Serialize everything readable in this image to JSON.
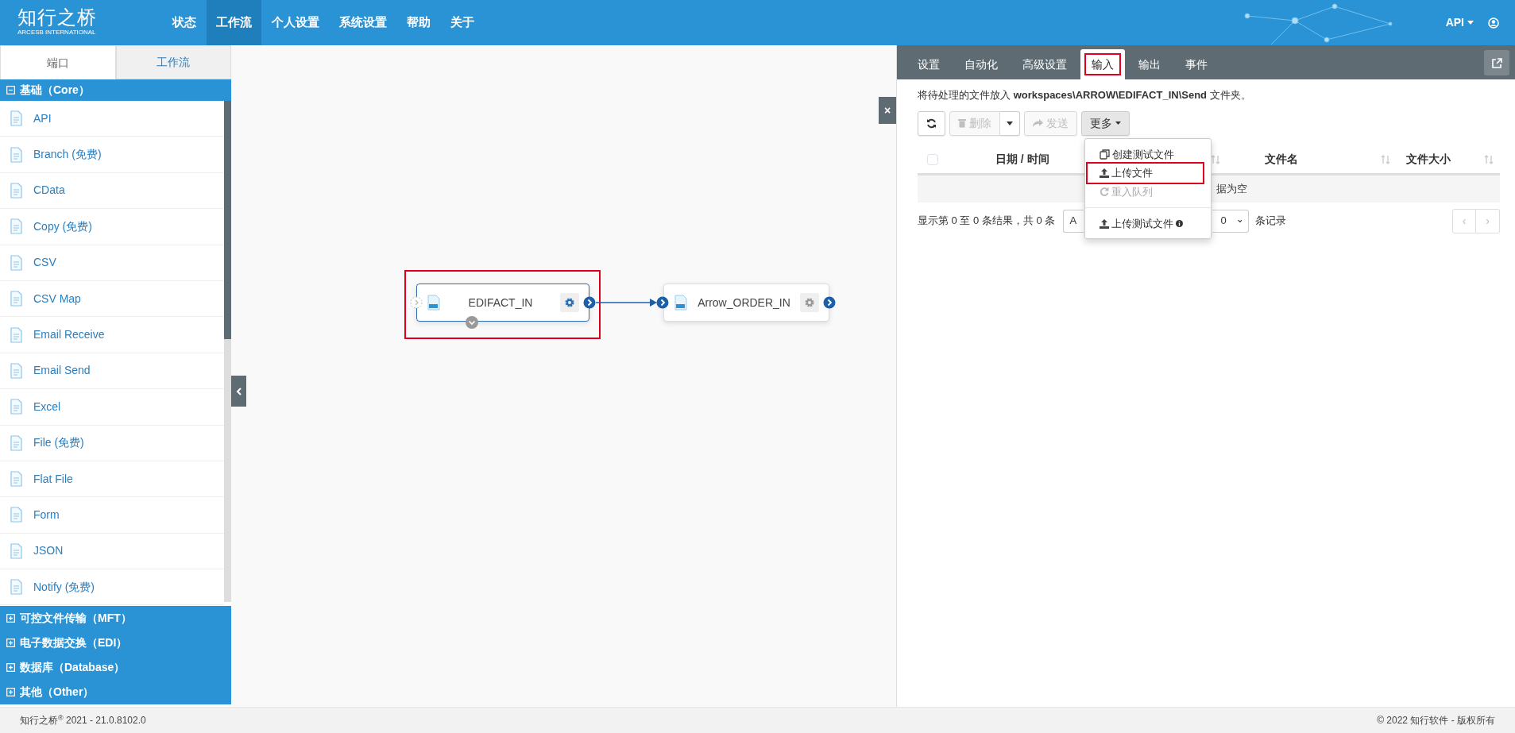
{
  "navbar": {
    "logo": "知行之桥",
    "logo_subtitle": "ARCESB INTERNATIONAL",
    "items": [
      {
        "label": "状态",
        "selected": false
      },
      {
        "label": "工作流",
        "selected": true
      },
      {
        "label": "个人设置",
        "selected": false
      },
      {
        "label": "系统设置",
        "selected": false
      },
      {
        "label": "帮助",
        "selected": false
      },
      {
        "label": "关于",
        "selected": false
      }
    ],
    "user_menu": "API"
  },
  "sidebar": {
    "tabs": [
      {
        "label": "端口",
        "selected": true
      },
      {
        "label": "工作流",
        "selected": false
      }
    ],
    "groups": [
      {
        "label": "基础（Core）",
        "expanded": true,
        "items": [
          "API",
          "Branch (免费)",
          "CData",
          "Copy (免费)",
          "CSV",
          "CSV Map",
          "Email Receive",
          "Email Send",
          "Excel",
          "File (免费)",
          "Flat File",
          "Form",
          "JSON",
          "Notify (免费)"
        ]
      },
      {
        "label": "可控文件传输（MFT）",
        "expanded": false
      },
      {
        "label": "电子数据交换（EDI）",
        "expanded": false
      },
      {
        "label": "数据库（Database）",
        "expanded": false
      },
      {
        "label": "其他（Other）",
        "expanded": false
      }
    ]
  },
  "canvas": {
    "close_label": "×",
    "nodes": [
      {
        "label": "EDIFACT_IN",
        "selected": true,
        "highlighted": true
      },
      {
        "label": "Arrow_ORDER_IN",
        "selected": false,
        "highlighted": false
      }
    ]
  },
  "panel": {
    "tabs": [
      {
        "label": "设置",
        "selected": false,
        "highlighted": false
      },
      {
        "label": "自动化",
        "selected": false,
        "highlighted": false
      },
      {
        "label": "高级设置",
        "selected": false,
        "highlighted": false
      },
      {
        "label": "输入",
        "selected": true,
        "highlighted": true
      },
      {
        "label": "输出",
        "selected": false,
        "highlighted": false
      },
      {
        "label": "事件",
        "selected": false,
        "highlighted": false
      }
    ],
    "description": "将待处理的文件放入 **workspaces\\ARROW\\EDIFACT_IN\\Send** 文件夹。",
    "toolbar": [
      {
        "kind": "refresh",
        "disabled": false
      },
      {
        "kind": "delete",
        "label": "删除",
        "disabled": true
      },
      {
        "kind": "send",
        "label": "发送",
        "disabled": true
      },
      {
        "kind": "more",
        "label": "更多",
        "disabled": false,
        "expanded": true
      }
    ],
    "menu": [
      {
        "kind": "copy",
        "label": "创建测试文件",
        "disabled": false,
        "highlighted": false
      },
      {
        "kind": "upload",
        "label": "上传文件",
        "disabled": false,
        "highlighted": true
      },
      {
        "kind": "requeue",
        "label": "重入队列",
        "disabled": true,
        "highlighted": false
      },
      {
        "kind": "upload",
        "label": "上传测试文件",
        "disabled": false,
        "highlighted": false,
        "info": true
      }
    ],
    "table": {
      "select_all_checked": false,
      "columns": [
        "日期 / 时间",
        "文件名",
        "文件大小"
      ],
      "empty_text": "据为空"
    },
    "info": "显示第 0 至 0 条结果，共 0 条",
    "page_select_1": "A",
    "page_select_2": "0",
    "page_suffix": "条记录",
    "pagination": [
      {
        "label": "‹",
        "disabled": true
      },
      {
        "label": "›",
        "disabled": true
      }
    ]
  },
  "footer": {
    "left": "知行之桥$^{®}$ 2021 - 21.0.8102.0",
    "right": "© 2022 知行软件 - 版权所有"
  }
}
